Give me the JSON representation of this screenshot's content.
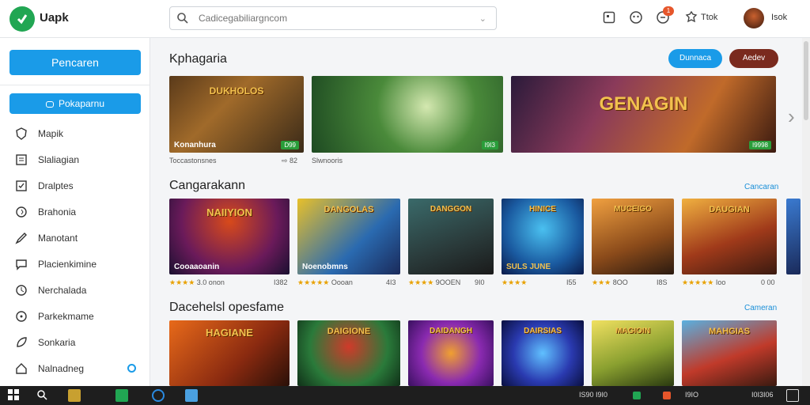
{
  "header": {
    "app_name": "Uapk",
    "search_placeholder": "Cadicegabiliargncom",
    "label_right": "Ttok",
    "user_name": "Isok",
    "notification_count": "1"
  },
  "sidebar": {
    "primary_button": "Pencaren",
    "secondary_button": "Pokaparnu",
    "items": [
      {
        "label": "Mapik",
        "icon": "shield-icon"
      },
      {
        "label": "Slaliagian",
        "icon": "document-icon"
      },
      {
        "label": "Dralptes",
        "icon": "check-square-icon"
      },
      {
        "label": "Brahonia",
        "icon": "globe-icon"
      },
      {
        "label": "Manotant",
        "icon": "pen-icon"
      },
      {
        "label": "Placienkimine",
        "icon": "chat-icon"
      },
      {
        "label": "Nerchalada",
        "icon": "bag-icon"
      },
      {
        "label": "Parkekmame",
        "icon": "clock-icon"
      },
      {
        "label": "Sonkaria",
        "icon": "leaf-icon"
      },
      {
        "label": "Nalnadneg",
        "icon": "home-icon"
      }
    ]
  },
  "featured": {
    "title": "Kphagaria",
    "button_blue": "Dunnaca",
    "button_dark": "Aedev",
    "cards": [
      {
        "title_art": "DUKHOLOS",
        "label": "Konanhura",
        "badge": "D99",
        "caption": "Toccastonsnes",
        "price": "⇨ 82"
      },
      {
        "title_art": "",
        "label": "",
        "badge": "I9I3",
        "caption": "Slwnooris",
        "price": ""
      },
      {
        "title_art": "GENAGIN",
        "label": "",
        "badge": "I9998",
        "caption": "",
        "price": ""
      }
    ]
  },
  "section2": {
    "title": "Cangarakann",
    "link": "Cancaran",
    "cards": [
      {
        "art": "NAIIYION",
        "label": "Cooaaoanin",
        "stars": "★★★★",
        "meta": "3.0 onon",
        "price": "I382"
      },
      {
        "art": "DANGOLAS",
        "label": "Noenobmns",
        "stars": "★★★★★",
        "meta": "Oooan",
        "price": "4I3"
      },
      {
        "art": "DANGGON",
        "label": "",
        "stars": "★★★★",
        "meta": "9OOEN",
        "price": "9I0"
      },
      {
        "art": "HINICE",
        "label": "SULS JUNE",
        "stars": "★★★★",
        "meta": "",
        "price": "I55"
      },
      {
        "art": "MUCEIGO",
        "label": "",
        "stars": "★★★",
        "meta": "8OO",
        "price": "I8S"
      },
      {
        "art": "DAUGIAN",
        "label": "",
        "stars": "★★★★★",
        "meta": "Ioo",
        "price": "0 00"
      }
    ]
  },
  "section3": {
    "title": "Dacehelsl opesfame",
    "link": "Cameran",
    "cards": [
      {
        "art": "HAGIANE"
      },
      {
        "art": "DAIGIONE"
      },
      {
        "art": "DAIDANGH"
      },
      {
        "art": "DAIRSIAS"
      },
      {
        "art": "MAGIOIN"
      },
      {
        "art": "MAHGIAS"
      }
    ]
  },
  "taskbar": {
    "tray_text": "IS90 I9I0",
    "clock": "I9IO",
    "date": "I0I3I06"
  },
  "colors": {
    "accent": "#1a9be8",
    "brand": "#21a653",
    "dark_button": "#7a2a1e"
  }
}
